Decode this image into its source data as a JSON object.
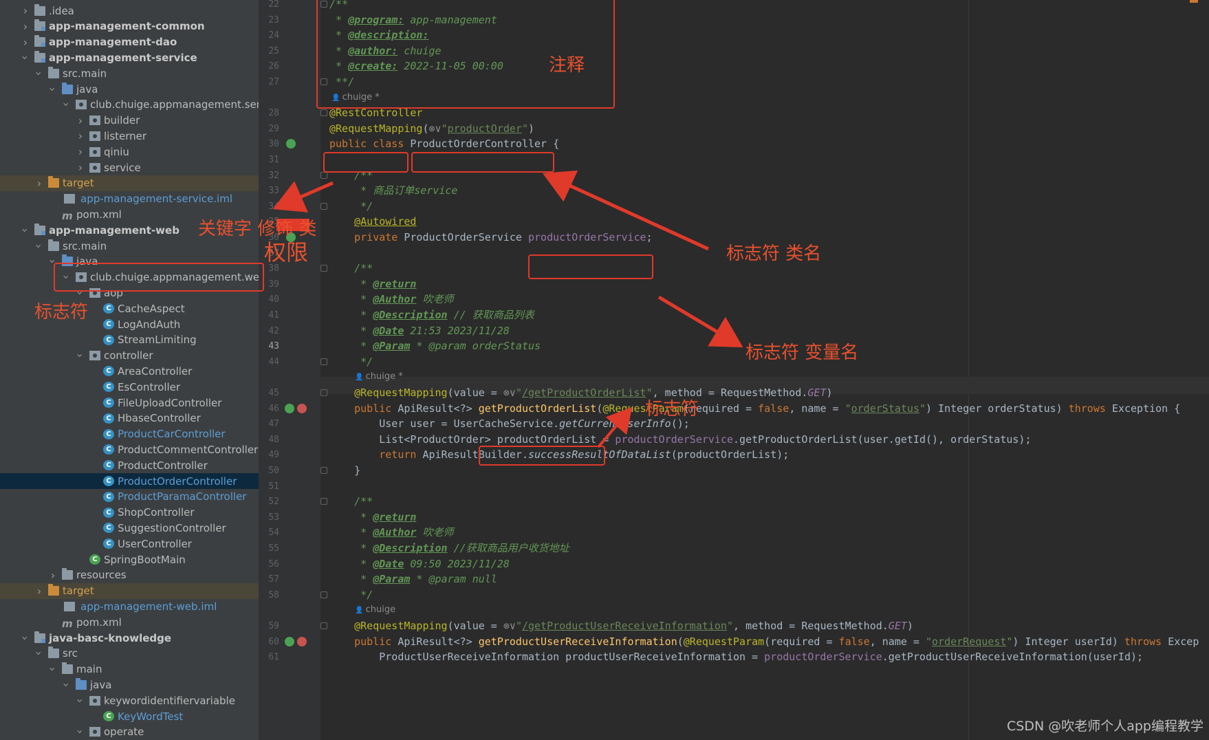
{
  "tree": [
    {
      "indent": 2,
      "arrow": "right",
      "icon": "folder",
      "label": ".idea",
      "style": ""
    },
    {
      "indent": 2,
      "arrow": "right",
      "icon": "module",
      "label": "app-management-common",
      "style": "bold"
    },
    {
      "indent": 2,
      "arrow": "right",
      "icon": "module",
      "label": "app-management-dao",
      "style": "bold"
    },
    {
      "indent": 2,
      "arrow": "down",
      "icon": "module",
      "label": "app-management-service",
      "style": "bold"
    },
    {
      "indent": 3,
      "arrow": "down",
      "icon": "folder",
      "label": "src.main",
      "style": ""
    },
    {
      "indent": 4,
      "arrow": "down",
      "icon": "folder-blue",
      "label": "java",
      "style": ""
    },
    {
      "indent": 5,
      "arrow": "down",
      "icon": "pkg",
      "label": "club.chuige.appmanagement.servic",
      "style": ""
    },
    {
      "indent": 6,
      "arrow": "right",
      "icon": "pkg",
      "label": "builder",
      "style": ""
    },
    {
      "indent": 6,
      "arrow": "right",
      "icon": "pkg",
      "label": "listerner",
      "style": ""
    },
    {
      "indent": 6,
      "arrow": "right",
      "icon": "pkg",
      "label": "qiniu",
      "style": ""
    },
    {
      "indent": 6,
      "arrow": "right",
      "icon": "pkg",
      "label": "service",
      "style": ""
    },
    {
      "indent": 3,
      "arrow": "right",
      "icon": "folder-orange",
      "label": "target",
      "style": "orange",
      "row": "hl-target"
    },
    {
      "indent": 4,
      "arrow": "",
      "icon": "iml",
      "label": "app-management-service.iml",
      "style": "blue"
    },
    {
      "indent": 4,
      "arrow": "",
      "icon": "mvn",
      "label": "pom.xml",
      "style": ""
    },
    {
      "indent": 2,
      "arrow": "down",
      "icon": "module",
      "label": "app-management-web",
      "style": "bold"
    },
    {
      "indent": 3,
      "arrow": "down",
      "icon": "folder",
      "label": "src.main",
      "style": ""
    },
    {
      "indent": 4,
      "arrow": "down",
      "icon": "folder-blue",
      "label": "java",
      "style": ""
    },
    {
      "indent": 5,
      "arrow": "down",
      "icon": "pkg",
      "label": "club.chuige.appmanagement.web",
      "style": ""
    },
    {
      "indent": 6,
      "arrow": "down",
      "icon": "pkg",
      "label": "aop",
      "style": ""
    },
    {
      "indent": 7,
      "arrow": "",
      "icon": "cls",
      "label": "CacheAspect",
      "style": ""
    },
    {
      "indent": 7,
      "arrow": "",
      "icon": "cls",
      "label": "LogAndAuth",
      "style": ""
    },
    {
      "indent": 7,
      "arrow": "",
      "icon": "cls",
      "label": "StreamLimiting",
      "style": ""
    },
    {
      "indent": 6,
      "arrow": "down",
      "icon": "pkg",
      "label": "controller",
      "style": ""
    },
    {
      "indent": 7,
      "arrow": "",
      "icon": "cls",
      "label": "AreaController",
      "style": ""
    },
    {
      "indent": 7,
      "arrow": "",
      "icon": "cls",
      "label": "EsController",
      "style": ""
    },
    {
      "indent": 7,
      "arrow": "",
      "icon": "cls",
      "label": "FileUploadController",
      "style": ""
    },
    {
      "indent": 7,
      "arrow": "",
      "icon": "cls",
      "label": "HbaseController",
      "style": ""
    },
    {
      "indent": 7,
      "arrow": "",
      "icon": "cls",
      "label": "ProductCarController",
      "style": "blue"
    },
    {
      "indent": 7,
      "arrow": "",
      "icon": "cls",
      "label": "ProductCommentController",
      "style": ""
    },
    {
      "indent": 7,
      "arrow": "",
      "icon": "cls",
      "label": "ProductController",
      "style": ""
    },
    {
      "indent": 7,
      "arrow": "",
      "icon": "cls",
      "label": "ProductOrderController",
      "style": "blue",
      "row": "selected"
    },
    {
      "indent": 7,
      "arrow": "",
      "icon": "cls",
      "label": "ProductParamaController",
      "style": "blue"
    },
    {
      "indent": 7,
      "arrow": "",
      "icon": "cls",
      "label": "ShopController",
      "style": ""
    },
    {
      "indent": 7,
      "arrow": "",
      "icon": "cls",
      "label": "SuggestionController",
      "style": ""
    },
    {
      "indent": 7,
      "arrow": "",
      "icon": "cls",
      "label": "UserController",
      "style": ""
    },
    {
      "indent": 6,
      "arrow": "",
      "icon": "cls-green",
      "label": "SpringBootMain",
      "style": ""
    },
    {
      "indent": 4,
      "arrow": "right",
      "icon": "folder",
      "label": "resources",
      "style": ""
    },
    {
      "indent": 3,
      "arrow": "right",
      "icon": "folder-orange",
      "label": "target",
      "style": "orange",
      "row": "hl-target"
    },
    {
      "indent": 4,
      "arrow": "",
      "icon": "iml",
      "label": "app-management-web.iml",
      "style": "blue"
    },
    {
      "indent": 4,
      "arrow": "",
      "icon": "mvn",
      "label": "pom.xml",
      "style": ""
    },
    {
      "indent": 2,
      "arrow": "down",
      "icon": "module",
      "label": "java-basc-knowledge",
      "style": "bold"
    },
    {
      "indent": 3,
      "arrow": "down",
      "icon": "folder",
      "label": "src",
      "style": ""
    },
    {
      "indent": 4,
      "arrow": "down",
      "icon": "folder",
      "label": "main",
      "style": ""
    },
    {
      "indent": 5,
      "arrow": "down",
      "icon": "folder-blue",
      "label": "java",
      "style": ""
    },
    {
      "indent": 6,
      "arrow": "down",
      "icon": "pkg",
      "label": "keywordidentifiervariable",
      "style": ""
    },
    {
      "indent": 7,
      "arrow": "",
      "icon": "cls-green",
      "label": "KeyWordTest",
      "style": "blue"
    },
    {
      "indent": 6,
      "arrow": "down",
      "icon": "pkg",
      "label": "operate",
      "style": ""
    }
  ],
  "code": [
    {
      "ln": "22",
      "tokens": [
        [
          "/**",
          "com"
        ]
      ]
    },
    {
      "ln": "23",
      "tokens": [
        [
          " * ",
          "com"
        ],
        [
          "@program:",
          "tag"
        ],
        [
          " app-management",
          "com"
        ]
      ]
    },
    {
      "ln": "24",
      "tokens": [
        [
          " * ",
          "com"
        ],
        [
          "@description:",
          "tag"
        ]
      ]
    },
    {
      "ln": "25",
      "tokens": [
        [
          " * ",
          "com"
        ],
        [
          "@author:",
          "tag"
        ],
        [
          " chuige",
          "com"
        ]
      ]
    },
    {
      "ln": "26",
      "tokens": [
        [
          " * ",
          "com"
        ],
        [
          "@create:",
          "tag"
        ],
        [
          " 2022-11-05 00:00",
          "com"
        ]
      ]
    },
    {
      "ln": "27",
      "tokens": [
        [
          " **/",
          "com"
        ]
      ]
    },
    {
      "ln": "",
      "hint": "chuige *"
    },
    {
      "ln": "28",
      "tokens": [
        [
          "@RestController",
          "ann"
        ]
      ]
    },
    {
      "ln": "29",
      "tokens": [
        [
          "@RequestMapping",
          "ann"
        ],
        [
          "(",
          ""
        ],
        [
          "⊗∨",
          "gray"
        ],
        [
          "\"",
          "str"
        ],
        [
          "productOrder",
          "stru"
        ],
        [
          "\"",
          "str"
        ],
        [
          ")",
          ""
        ]
      ]
    },
    {
      "ln": "30",
      "tokens": [
        [
          "public class ",
          "kw"
        ],
        [
          "ProductOrderController",
          ""
        ],
        [
          " {",
          ""
        ]
      ]
    },
    {
      "ln": "31",
      "tokens": []
    },
    {
      "ln": "32",
      "tokens": [
        [
          "    /**",
          "com"
        ]
      ]
    },
    {
      "ln": "33",
      "tokens": [
        [
          "     * 商品订单service",
          "com"
        ]
      ]
    },
    {
      "ln": "34",
      "tokens": [
        [
          "     */",
          "com"
        ]
      ]
    },
    {
      "ln": "35",
      "tokens": [
        [
          "    ",
          ""
        ],
        [
          "@Autowired",
          "annu"
        ]
      ]
    },
    {
      "ln": "36",
      "tokens": [
        [
          "    private ",
          "kw"
        ],
        [
          "ProductOrderService ",
          ""
        ],
        [
          "productOrderService",
          "fld"
        ],
        [
          ";",
          ""
        ]
      ]
    },
    {
      "ln": "37",
      "tokens": []
    },
    {
      "ln": "38",
      "tokens": [
        [
          "    /**",
          "com"
        ]
      ]
    },
    {
      "ln": "39",
      "tokens": [
        [
          "     * ",
          "com"
        ],
        [
          "@return",
          "tag"
        ]
      ]
    },
    {
      "ln": "40",
      "tokens": [
        [
          "     * ",
          "com"
        ],
        [
          "@Author",
          "tag"
        ],
        [
          " 吹老师",
          "com"
        ]
      ]
    },
    {
      "ln": "41",
      "tokens": [
        [
          "     * ",
          "com"
        ],
        [
          "@Description",
          "tag"
        ],
        [
          " // 获取商品列表",
          "com"
        ]
      ]
    },
    {
      "ln": "42",
      "tokens": [
        [
          "     * ",
          "com"
        ],
        [
          "@Date",
          "tag"
        ],
        [
          " 21:53 2023/11/28",
          "com"
        ]
      ]
    },
    {
      "ln": "43",
      "tokens": [
        [
          "     * ",
          "com"
        ],
        [
          "@Param",
          "tag"
        ],
        [
          " * @param orderStatus",
          "com"
        ]
      ]
    },
    {
      "ln": "44",
      "tokens": [
        [
          "     */",
          "com"
        ]
      ]
    },
    {
      "ln": "",
      "hint": "chuige *",
      "indent": true
    },
    {
      "ln": "45",
      "tokens": [
        [
          "    ",
          ""
        ],
        [
          "@RequestMapping",
          "ann"
        ],
        [
          "(value = ",
          ""
        ],
        [
          "⊗∨",
          "gray"
        ],
        [
          "\"",
          "str"
        ],
        [
          "/getProductOrderList",
          "stru"
        ],
        [
          "\"",
          "str"
        ],
        [
          ", method = RequestMethod.",
          ""
        ],
        [
          "GET",
          "fldit"
        ],
        [
          ")",
          ""
        ]
      ]
    },
    {
      "ln": "46",
      "tokens": [
        [
          "    public ",
          "kw"
        ],
        [
          "ApiResult<?> ",
          ""
        ],
        [
          "getProductOrderList",
          "fn"
        ],
        [
          "(",
          ""
        ],
        [
          "@RequestParam",
          "ann"
        ],
        [
          "(required = ",
          ""
        ],
        [
          "false",
          "kw"
        ],
        [
          ", name = ",
          ""
        ],
        [
          "\"",
          "str"
        ],
        [
          "orderStatus",
          "stru"
        ],
        [
          "\"",
          "str"
        ],
        [
          ") Integer orderStatus) ",
          ""
        ],
        [
          "throws ",
          "kw"
        ],
        [
          "Exception {",
          ""
        ]
      ]
    },
    {
      "ln": "47",
      "tokens": [
        [
          "        User user = UserCacheService.",
          ""
        ],
        [
          "getCurrentUserInfo",
          "it"
        ],
        [
          "();",
          ""
        ]
      ]
    },
    {
      "ln": "48",
      "tokens": [
        [
          "        List<ProductOrder> productOrderList = ",
          ""
        ],
        [
          "productOrderService",
          "fld"
        ],
        [
          ".getProductOrderList(user.getId(), orderStatus);",
          ""
        ]
      ]
    },
    {
      "ln": "49",
      "tokens": [
        [
          "        return ",
          "kw"
        ],
        [
          "ApiResultBuilder.",
          ""
        ],
        [
          "successResultOfDataList",
          "it"
        ],
        [
          "(productOrderList);",
          ""
        ]
      ]
    },
    {
      "ln": "50",
      "tokens": [
        [
          "    }",
          ""
        ]
      ]
    },
    {
      "ln": "51",
      "tokens": []
    },
    {
      "ln": "52",
      "tokens": [
        [
          "    /**",
          "com"
        ]
      ]
    },
    {
      "ln": "53",
      "tokens": [
        [
          "     * ",
          "com"
        ],
        [
          "@return",
          "tag"
        ]
      ]
    },
    {
      "ln": "54",
      "tokens": [
        [
          "     * ",
          "com"
        ],
        [
          "@Author",
          "tag"
        ],
        [
          " 吹老师",
          "com"
        ]
      ]
    },
    {
      "ln": "55",
      "tokens": [
        [
          "     * ",
          "com"
        ],
        [
          "@Description",
          "tag"
        ],
        [
          " //获取商品用户收货地址",
          "com"
        ]
      ]
    },
    {
      "ln": "56",
      "tokens": [
        [
          "     * ",
          "com"
        ],
        [
          "@Date",
          "tag"
        ],
        [
          " 09:50 2023/11/28",
          "com"
        ]
      ]
    },
    {
      "ln": "57",
      "tokens": [
        [
          "     * ",
          "com"
        ],
        [
          "@Param",
          "tag"
        ],
        [
          " * @param null",
          "com"
        ]
      ]
    },
    {
      "ln": "58",
      "tokens": [
        [
          "     */",
          "com"
        ]
      ]
    },
    {
      "ln": "",
      "hint": "chuige",
      "indent": true
    },
    {
      "ln": "59",
      "tokens": [
        [
          "    ",
          ""
        ],
        [
          "@RequestMapping",
          "ann"
        ],
        [
          "(value = ",
          ""
        ],
        [
          "⊗∨",
          "gray"
        ],
        [
          "\"",
          "str"
        ],
        [
          "/getProductUserReceiveInformation",
          "stru"
        ],
        [
          "\"",
          "str"
        ],
        [
          ", method = RequestMethod.",
          ""
        ],
        [
          "GET",
          "fldit"
        ],
        [
          ")",
          ""
        ]
      ]
    },
    {
      "ln": "60",
      "tokens": [
        [
          "    public ",
          "kw"
        ],
        [
          "ApiResult<?> ",
          ""
        ],
        [
          "getProductUserReceiveInformation",
          "fn"
        ],
        [
          "(",
          ""
        ],
        [
          "@RequestParam",
          "ann"
        ],
        [
          "(required = ",
          ""
        ],
        [
          "false",
          "kw"
        ],
        [
          ", name = ",
          ""
        ],
        [
          "\"",
          "str"
        ],
        [
          "orderRequest",
          "stru"
        ],
        [
          "\"",
          "str"
        ],
        [
          ") Integer userId) ",
          ""
        ],
        [
          "throws ",
          "kw"
        ],
        [
          "Excep",
          ""
        ]
      ]
    },
    {
      "ln": "61",
      "tokens": [
        [
          "        ProductUserReceiveInformation productUserReceiveInformation = ",
          ""
        ],
        [
          "productOrderService",
          "fld"
        ],
        [
          ".getProductUserReceiveInformation(userId);",
          ""
        ]
      ]
    }
  ],
  "annotations": {
    "comment": "注释",
    "keyword": "关键字 修饰 类",
    "keyword_obscured_part": "修饰",
    "permission": "权限",
    "identifier_left": "标志符",
    "identifier_class": "标志符 类名",
    "identifier_var": "标志符  变量名",
    "identifier_method": "标志符"
  },
  "watermark": "CSDN @吹老师个人app编程教学",
  "colors": {
    "annotation_red": "#e8512e",
    "selection": "#0d293e"
  }
}
